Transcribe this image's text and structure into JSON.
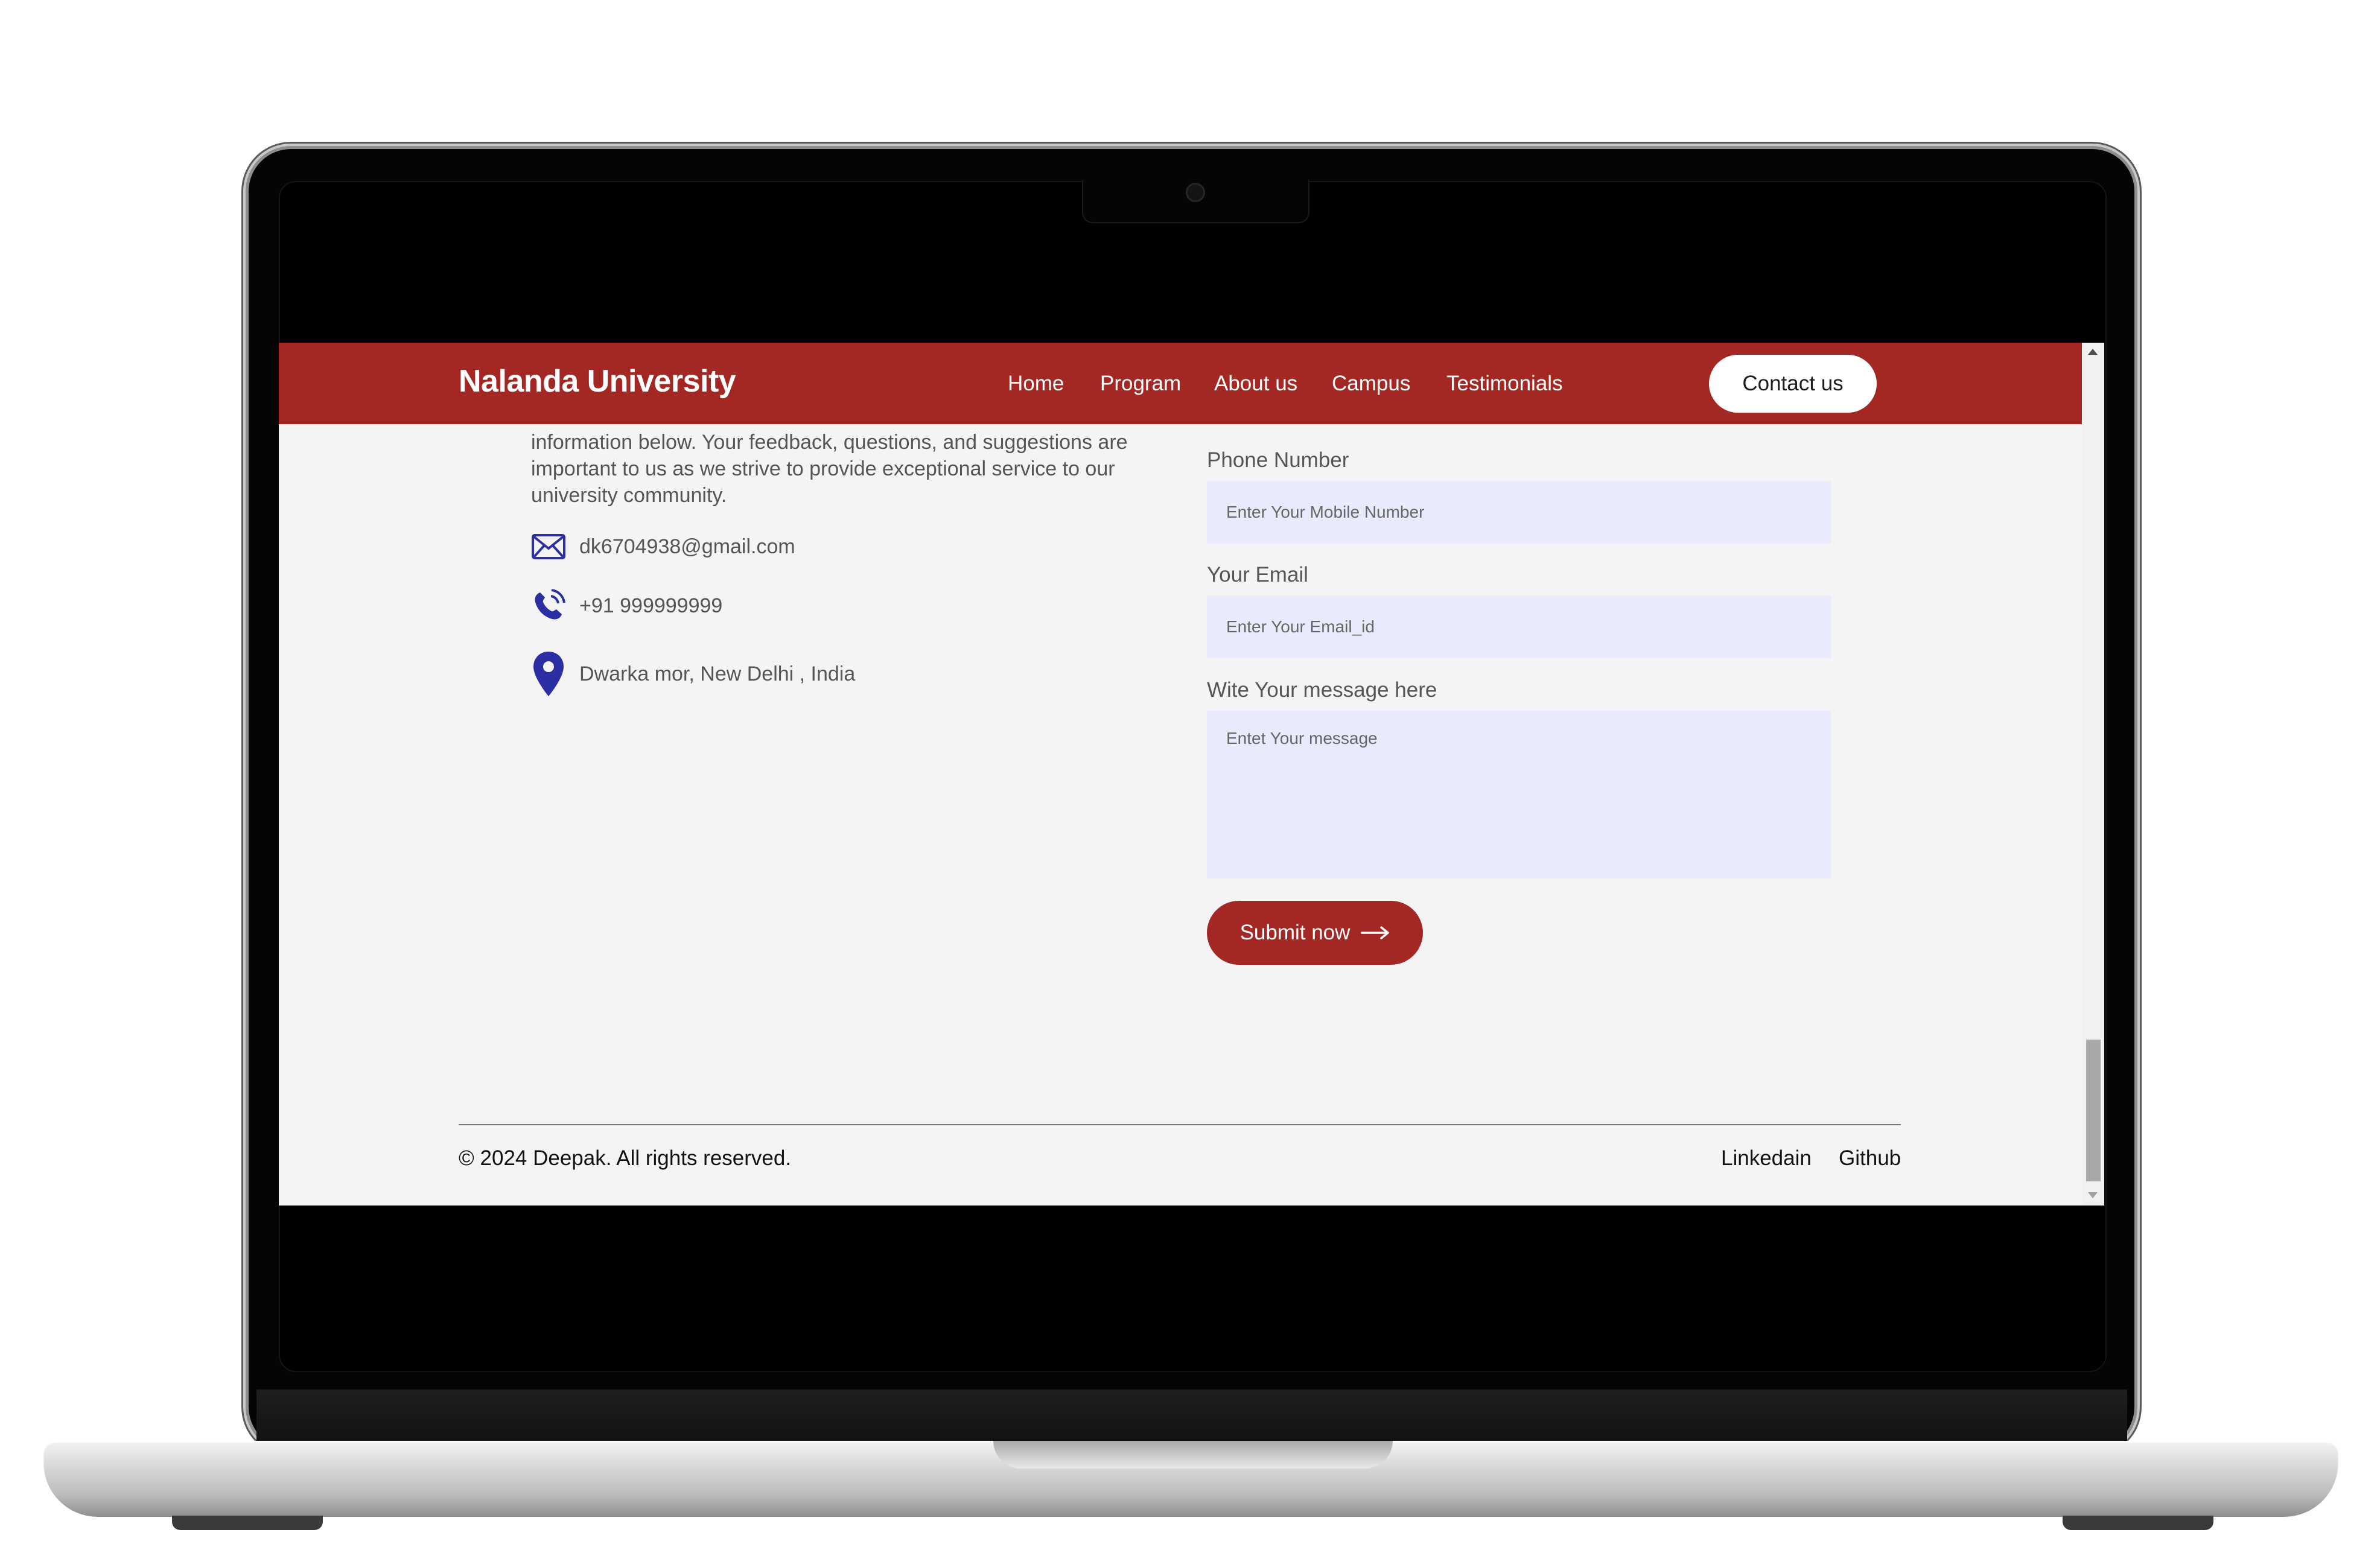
{
  "site": {
    "brand": "Nalanda University",
    "nav": [
      {
        "label": "Home"
      },
      {
        "label": "Program"
      },
      {
        "label": "About us"
      },
      {
        "label": "Campus"
      },
      {
        "label": "Testimonials"
      }
    ],
    "contact_button": "Contact us"
  },
  "contact_info": {
    "intro": "information below. Your feedback, questions, and suggestions are important to us as we strive to provide exceptional service to our university community.",
    "email": "dk6704938@gmail.com",
    "phone": "+91 999999999",
    "address": "Dwarka mor, New Delhi , India",
    "icon_color": "#2b2fa3"
  },
  "form": {
    "phone_label": "Phone Number",
    "phone_placeholder": "Enter Your Mobile Number",
    "email_label": "Your Email",
    "email_placeholder": "Enter Your Email_id",
    "message_label": "Wite Your message here",
    "message_placeholder": "Entet Your message",
    "submit_label": "Submit now"
  },
  "footer": {
    "copyright": "© 2024 Deepak. All rights reserved.",
    "links": [
      {
        "label": "Linkedain"
      },
      {
        "label": "Github"
      }
    ]
  },
  "theme": {
    "primary": "#a32823",
    "input_bg": "#e9eafc",
    "page_bg": "#f4f4f4"
  }
}
